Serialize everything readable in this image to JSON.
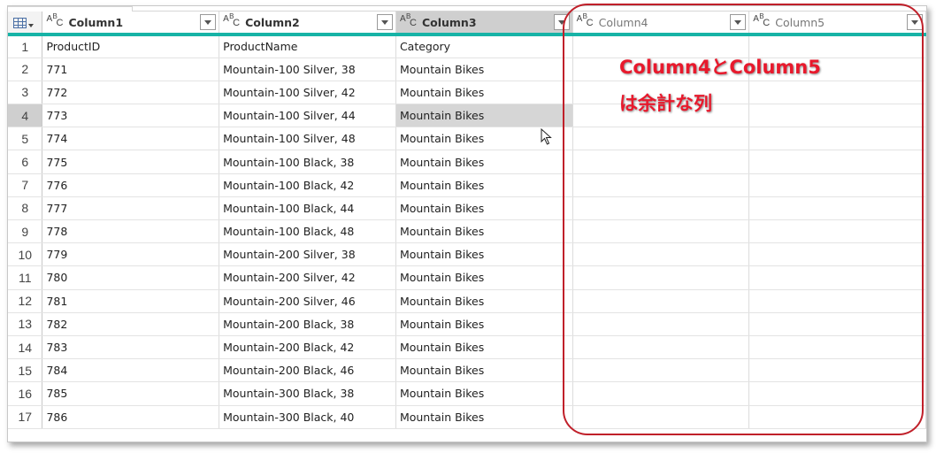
{
  "columns": [
    {
      "label": "Column1",
      "type_icon": "text-type-icon"
    },
    {
      "label": "Column2",
      "type_icon": "text-type-icon"
    },
    {
      "label": "Column3",
      "type_icon": "text-type-icon"
    },
    {
      "label": "Column4",
      "type_icon": "text-type-icon"
    },
    {
      "label": "Column5",
      "type_icon": "text-type-icon"
    }
  ],
  "type_icon_glyphs": {
    "a": "A",
    "b": "B",
    "c": "C"
  },
  "rows": [
    {
      "num": "1",
      "cells": [
        "ProductID",
        "ProductName",
        "Category",
        "",
        ""
      ]
    },
    {
      "num": "2",
      "cells": [
        "771",
        "Mountain-100 Silver, 38",
        "Mountain Bikes",
        "",
        ""
      ]
    },
    {
      "num": "3",
      "cells": [
        "772",
        "Mountain-100 Silver, 42",
        "Mountain Bikes",
        "",
        ""
      ]
    },
    {
      "num": "4",
      "cells": [
        "773",
        "Mountain-100 Silver, 44",
        "Mountain Bikes",
        "",
        ""
      ]
    },
    {
      "num": "5",
      "cells": [
        "774",
        "Mountain-100 Silver, 48",
        "Mountain Bikes",
        "",
        ""
      ]
    },
    {
      "num": "6",
      "cells": [
        "775",
        "Mountain-100 Black, 38",
        "Mountain Bikes",
        "",
        ""
      ]
    },
    {
      "num": "7",
      "cells": [
        "776",
        "Mountain-100 Black, 42",
        "Mountain Bikes",
        "",
        ""
      ]
    },
    {
      "num": "8",
      "cells": [
        "777",
        "Mountain-100 Black, 44",
        "Mountain Bikes",
        "",
        ""
      ]
    },
    {
      "num": "9",
      "cells": [
        "778",
        "Mountain-100 Black, 48",
        "Mountain Bikes",
        "",
        ""
      ]
    },
    {
      "num": "10",
      "cells": [
        "779",
        "Mountain-200 Silver, 38",
        "Mountain Bikes",
        "",
        ""
      ]
    },
    {
      "num": "11",
      "cells": [
        "780",
        "Mountain-200 Silver, 42",
        "Mountain Bikes",
        "",
        ""
      ]
    },
    {
      "num": "12",
      "cells": [
        "781",
        "Mountain-200 Silver, 46",
        "Mountain Bikes",
        "",
        ""
      ]
    },
    {
      "num": "13",
      "cells": [
        "782",
        "Mountain-200 Black, 38",
        "Mountain Bikes",
        "",
        ""
      ]
    },
    {
      "num": "14",
      "cells": [
        "783",
        "Mountain-200 Black, 42",
        "Mountain Bikes",
        "",
        ""
      ]
    },
    {
      "num": "15",
      "cells": [
        "784",
        "Mountain-200 Black, 46",
        "Mountain Bikes",
        "",
        ""
      ]
    },
    {
      "num": "16",
      "cells": [
        "785",
        "Mountain-300 Black, 38",
        "Mountain Bikes",
        "",
        ""
      ]
    },
    {
      "num": "17",
      "cells": [
        "786",
        "Mountain-300 Black, 40",
        "Mountain Bikes",
        "",
        ""
      ]
    }
  ],
  "selected_column": "Column3",
  "selected_row": "4",
  "annotation": {
    "line1": "Column4とColumn5",
    "line2": "は余計な列",
    "color": "#e8192c"
  },
  "colors": {
    "header_underline": "#17b3a6",
    "selection": "#cfcfcf",
    "annotation_border": "#c0202a"
  }
}
